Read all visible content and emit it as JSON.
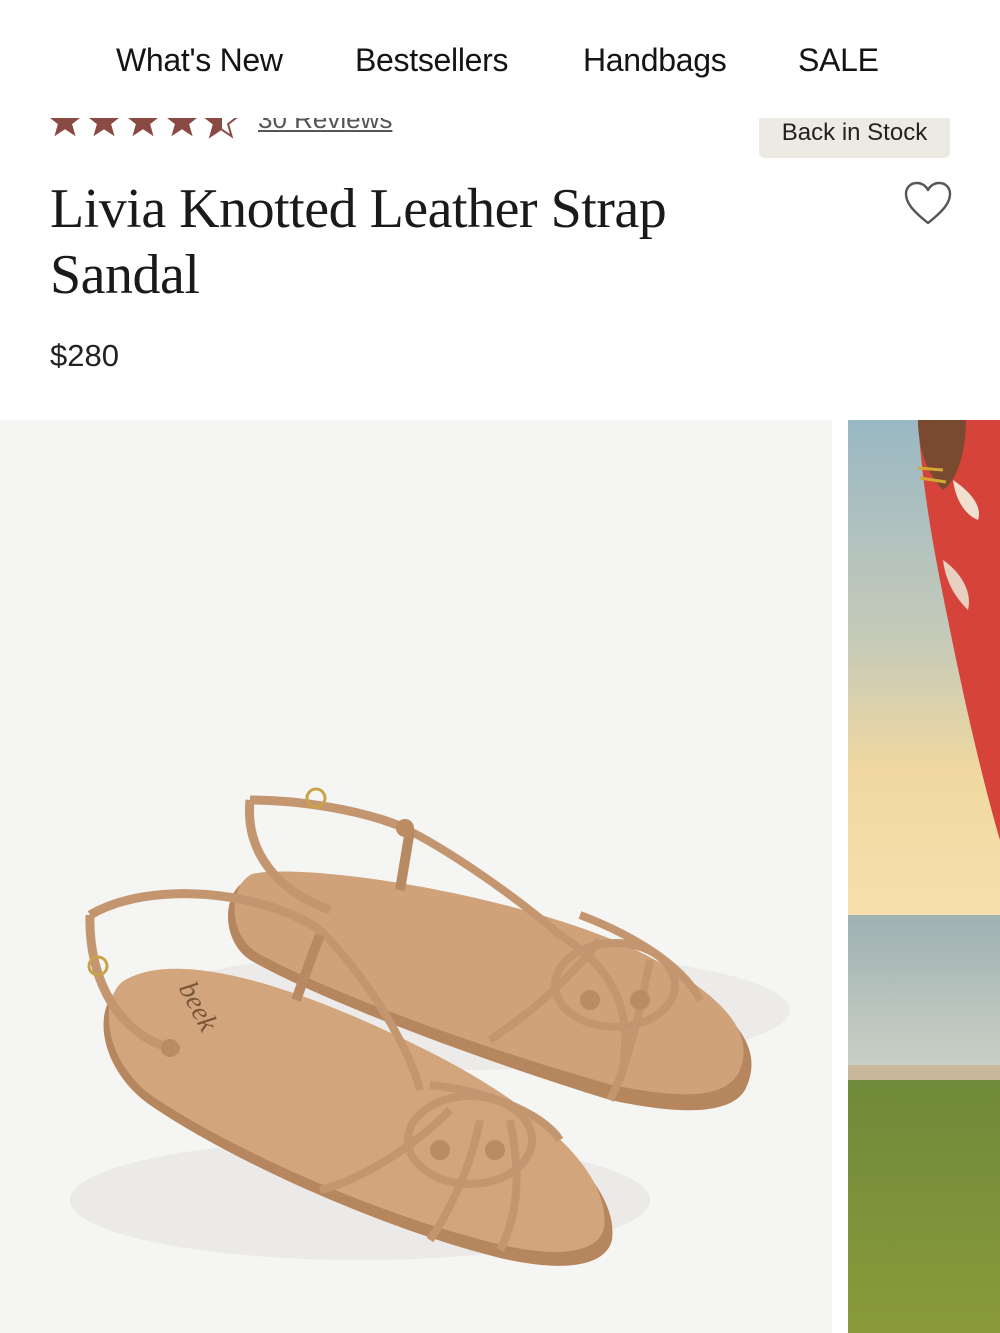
{
  "nav": {
    "items": [
      {
        "label": "What's New"
      },
      {
        "label": "Bestsellers"
      },
      {
        "label": "Handbags"
      },
      {
        "label": "SALE"
      }
    ]
  },
  "product": {
    "rating": 4.5,
    "reviews_label": "30 Reviews",
    "badge": "Back in Stock",
    "title": "Livia Knotted Leather Strap Sandal",
    "price": "$280",
    "insole_logo": "beek"
  },
  "icons": {
    "wishlist": "heart-outline-icon",
    "star": "star-icon"
  },
  "colors": {
    "star": "#8a4a44",
    "badge_bg": "#ede9e3",
    "leather": "#c99a71",
    "gallery_bg": "#f5f5f4"
  }
}
